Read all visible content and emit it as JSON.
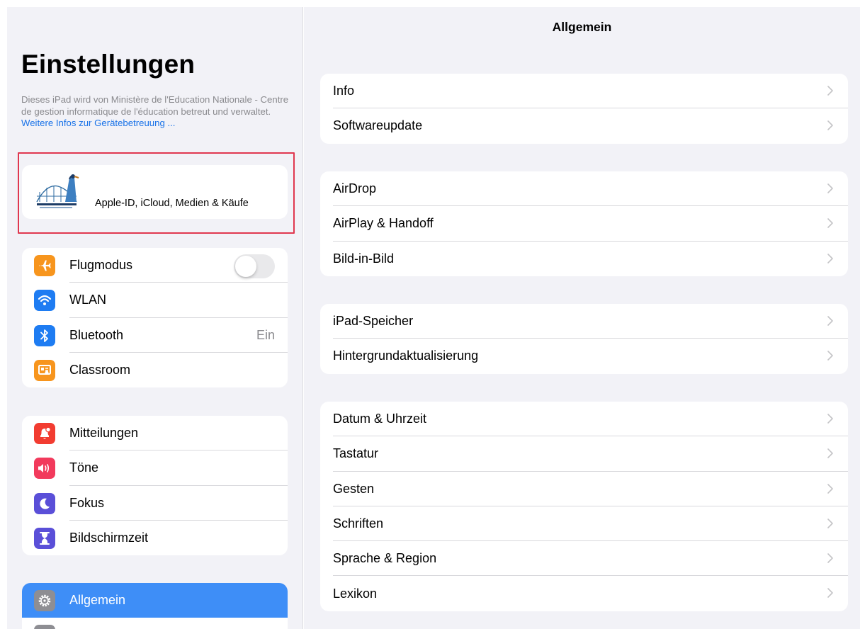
{
  "sidebar": {
    "title": "Einstellungen",
    "management_note": "Dieses iPad wird von Ministère de l'Education Nationale - Centre de gestion informatique de l'éducation betreut und verwaltet.",
    "management_link": "Weitere Infos zur Gerätebetreuung ...",
    "account_label": "Apple-ID, iCloud, Medien & Käufe",
    "group1": [
      {
        "label": "Flugmodus",
        "icon": "airplane-icon",
        "color": "#f7951d",
        "toggle": false
      },
      {
        "label": "WLAN",
        "icon": "wifi-icon",
        "color": "#1e7cf2"
      },
      {
        "label": "Bluetooth",
        "icon": "bluetooth-icon",
        "color": "#1e7cf2",
        "value": "Ein"
      },
      {
        "label": "Classroom",
        "icon": "classroom-icon",
        "color": "#f7951d"
      }
    ],
    "group2": [
      {
        "label": "Mitteilungen",
        "icon": "notifications-icon",
        "color": "#f23c31"
      },
      {
        "label": "Töne",
        "icon": "sound-icon",
        "color": "#f23a5c"
      },
      {
        "label": "Fokus",
        "icon": "moon-icon",
        "color": "#5a4fd8"
      },
      {
        "label": "Bildschirmzeit",
        "icon": "hourglass-icon",
        "color": "#5a4fd8"
      }
    ],
    "group3": [
      {
        "label": "Allgemein",
        "icon": "gear-icon",
        "color": "#8e8e93",
        "selected": true
      }
    ]
  },
  "detail": {
    "title": "Allgemein",
    "groups": [
      [
        "Info",
        "Softwareupdate"
      ],
      [
        "AirDrop",
        "AirPlay & Handoff",
        "Bild-in-Bild"
      ],
      [
        "iPad-Speicher",
        "Hintergrundaktualisierung"
      ],
      [
        "Datum & Uhrzeit",
        "Tastatur",
        "Gesten",
        "Schriften",
        "Sprache & Region",
        "Lexikon"
      ]
    ]
  }
}
